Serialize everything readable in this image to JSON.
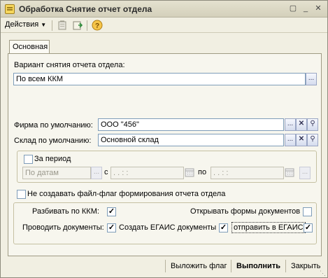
{
  "window": {
    "title": "Обработка  Снятие отчет отдела"
  },
  "toolbar": {
    "actions_label": "Действия",
    "help_label": "?"
  },
  "tabs": [
    "Основная"
  ],
  "variant": {
    "label": "Вариант снятия отчета отдела:",
    "value": "По всем ККМ"
  },
  "firm": {
    "label": "Фирма по умолчанию:",
    "value": "ООО \"456\""
  },
  "warehouse": {
    "label": "Склад по умолчанию:",
    "value": "Основной склад"
  },
  "period": {
    "checkbox_label": "За период",
    "mode_value": "По датам",
    "from_label": "с",
    "from_value": " .  .      :  :",
    "to_label": "по",
    "to_value": " .  .      :  :"
  },
  "no_flag": {
    "label": "Не создавать файл-флаг формирования отчета отдела"
  },
  "options": {
    "split_kkm": "Разбивать по ККМ:",
    "open_forms": "Открывать формы документов",
    "post_docs": "Проводить документы:",
    "create_egais": "Создать ЕГАИС документы",
    "send_egais": "отправить в ЕГАИС"
  },
  "footer": {
    "upload_flag": "Выложить флаг",
    "execute": "Выполнить",
    "close": "Закрыть"
  }
}
